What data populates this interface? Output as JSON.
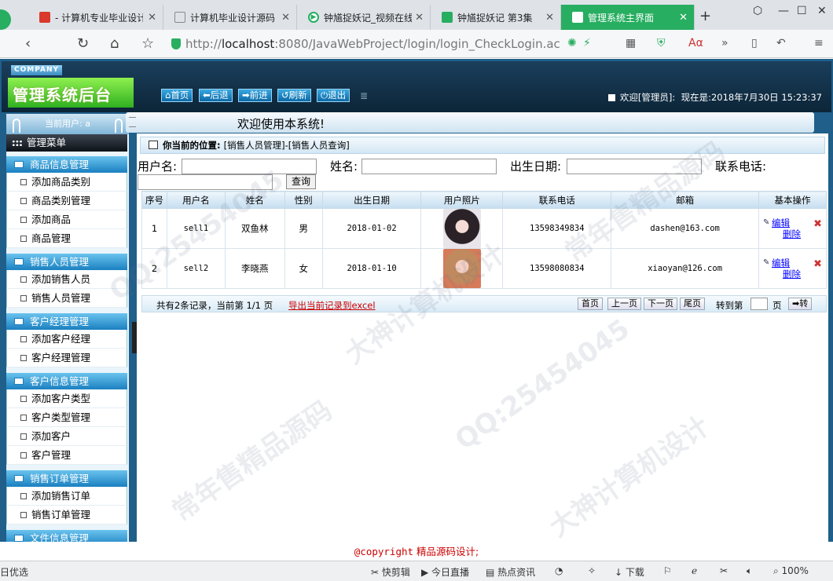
{
  "browser": {
    "tabs": [
      {
        "title": "- 计算机专业毕业设计",
        "icon_color": "#d9382b"
      },
      {
        "title": "计算机毕业设计源码",
        "icon_color": "#aaaaaa"
      },
      {
        "title": "钟馗捉妖记_视频在线",
        "icon_color": "#27ae60"
      },
      {
        "title": "钟馗捉妖记 第3集",
        "icon_color": "#27ae60"
      },
      {
        "title": "管理系统主界面",
        "icon_color": "#ffffff"
      }
    ],
    "url_prefix": "http://",
    "url_host": "localhost",
    "url_path": ":8080/JavaWebProject/login/login_CheckLogin.ac"
  },
  "header": {
    "company": "COMPANY",
    "brand": "管理系统后台",
    "buttons": [
      "首页",
      "后退",
      "前进",
      "刷新",
      "退出"
    ],
    "welcome_user": "欢迎[管理员]:",
    "now_label": "现在是:",
    "datetime": "2018年7月30日 15:23:37"
  },
  "sidebar": {
    "current_user": "当前用户: a",
    "menu_title": "管理菜单",
    "sections": [
      {
        "title": "商品信息管理",
        "items": [
          "添加商品类别",
          "商品类别管理",
          "添加商品",
          "商品管理"
        ]
      },
      {
        "title": "销售人员管理",
        "items": [
          "添加销售人员",
          "销售人员管理"
        ]
      },
      {
        "title": "客户经理管理",
        "items": [
          "添加客户经理",
          "客户经理管理"
        ]
      },
      {
        "title": "客户信息管理",
        "items": [
          "添加客户类型",
          "客户类型管理",
          "添加客户",
          "客户管理"
        ]
      },
      {
        "title": "销售订单管理",
        "items": [
          "添加销售订单",
          "销售订单管理"
        ]
      },
      {
        "title": "文件信息管理",
        "items": []
      }
    ]
  },
  "main": {
    "welcome": "欢迎使用本系统!",
    "location_label": "你当前的位置:",
    "location_path": "[销售人员管理]-[销售人员查询]",
    "search": {
      "username_label": "用户名:",
      "name_label": "姓名:",
      "birth_label": "出生日期:",
      "phone_label": "联系电话:",
      "query_button": "查询"
    },
    "table": {
      "headers": [
        "序号",
        "用户名",
        "姓名",
        "性别",
        "出生日期",
        "用户照片",
        "联系电话",
        "邮箱",
        "基本操作"
      ],
      "rows": [
        {
          "no": "1",
          "username": "sell1",
          "name": "双鱼林",
          "sex": "男",
          "birth": "2018-01-02",
          "phone": "13598349834",
          "email": "dashen@163.com"
        },
        {
          "no": "2",
          "username": "sell2",
          "name": "李晓燕",
          "sex": "女",
          "birth": "2018-01-10",
          "phone": "13598080834",
          "email": "xiaoyan@126.com"
        }
      ],
      "edit_label": "编辑",
      "delete_label": "删除"
    },
    "pager": {
      "summary": "共有2条记录，当前第 1/1 页",
      "export": "导出当前记录到excel",
      "first": "首页",
      "prev": "上一页",
      "next": "下一页",
      "last": "尾页",
      "goto_label": "转到第",
      "page_unit": "页",
      "go": "转"
    }
  },
  "footer": {
    "copyright": "@copyright",
    "text": "精品源码设计;"
  },
  "statusbar": {
    "left": "日优选",
    "items": [
      "快剪辑",
      "今日直播",
      "热点资讯",
      "下载",
      "100%"
    ]
  },
  "watermark": [
    "QQ:25454045",
    "大神计算机设计",
    "常年售精品源码"
  ]
}
